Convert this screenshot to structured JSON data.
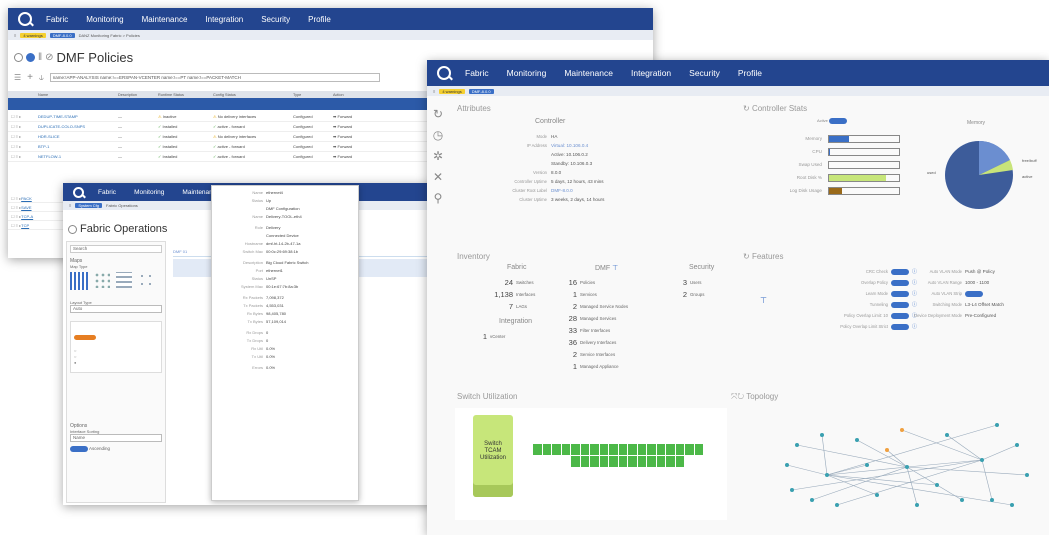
{
  "nav": {
    "items": [
      "Fabric",
      "Monitoring",
      "Maintenance",
      "Integration",
      "Security",
      "Profile"
    ]
  },
  "policies": {
    "warnings": "4 warnings",
    "version": "DMF-8.0.0",
    "crumb": "DANZ Monitoring Fabric > Policies",
    "title": "DMF Policies",
    "filter": "name:!APP-ANALYSIS name:!==ERSPAN-VCENTER name:!==PT name:!==PACKET-MATCH",
    "headers": [
      "Name",
      "Description",
      "Runtime Status",
      "Config Status",
      "Type",
      "Action"
    ],
    "rows": [
      {
        "name": "DEDUP-TIME-STAMP",
        "desc": "—",
        "run": "Inactive",
        "cfg": "No delivery interfaces",
        "type": "Configured",
        "act": "Forward"
      },
      {
        "name": "DUPLICATE-COLO-SNPS",
        "desc": "—",
        "run": "Installed",
        "cfg": "active - forward",
        "type": "Configured",
        "act": "Forward"
      },
      {
        "name": "HDR-SLICE",
        "desc": "—",
        "run": "Installed",
        "cfg": "No delivery interfaces",
        "type": "Configured",
        "act": "Forward"
      },
      {
        "name": "BTP-1",
        "desc": "—",
        "run": "Installed",
        "cfg": "active - forward",
        "type": "Configured",
        "act": "Forward"
      },
      {
        "name": "NETFLOW-1",
        "desc": "—",
        "run": "Installed",
        "cfg": "active - forward",
        "type": "Configured",
        "act": "Forward"
      }
    ],
    "extra_rows": [
      "PACK",
      "SAVE",
      "TCP-A",
      "TCP"
    ]
  },
  "fabric": {
    "sub_tag": "System Cfg",
    "crumb": "Fabric Operations",
    "title": "Fabric Operations",
    "search": "Search",
    "maps": "Maps",
    "map_type": "Map Type",
    "layout": "Layout Type",
    "layout_val": "Auto",
    "options": "Options",
    "interface_sorting": "Interface Sorting",
    "sort_val": "Name",
    "ascending": "Ascending",
    "colnote": "DMF 01",
    "details": [
      {
        "k": "Name",
        "v": "ethernet4"
      },
      {
        "k": "Status",
        "v": "Up"
      },
      {
        "k": "",
        "v": "DMF Configuration"
      },
      {
        "k": "Name",
        "v": "Delivery-TOOL-eth4"
      },
      {
        "k": "Role",
        "v": "Delivery"
      },
      {
        "k": "",
        "v": "Connected Device"
      },
      {
        "k": "Hostname",
        "v": "dmf-ht-14-2b-47-1a"
      },
      {
        "k": "Switch Mac",
        "v": "00:0c:29:69:38:1b"
      },
      {
        "k": "Description",
        "v": "Big Cloud Fabric Switch"
      },
      {
        "k": "Port",
        "v": "ethernet1"
      },
      {
        "k": "Status",
        "v": "UnSP"
      },
      {
        "k": "System Mac",
        "v": "00:1e:67:7b:8a:3b"
      },
      {
        "k": "Rx Packets",
        "v": "7,098,372"
      },
      {
        "k": "Tx Packets",
        "v": "4,553,031"
      },
      {
        "k": "Rx Bytes",
        "v": "98,405,780"
      },
      {
        "k": "Tx Bytes",
        "v": "57,109,014"
      },
      {
        "k": "Rx Drops",
        "v": "0"
      },
      {
        "k": "Tx Drops",
        "v": "0"
      },
      {
        "k": "Rx Util",
        "v": "0.0%"
      },
      {
        "k": "Tx Util",
        "v": "0.0%"
      },
      {
        "k": "Errors",
        "v": "0.0%"
      }
    ]
  },
  "dashboard": {
    "warnings": "4 warnings",
    "version": "DMF-8.0.0",
    "attributes": "Attributes",
    "controller": "Controller",
    "attr": [
      {
        "k": "Mode",
        "v": "HA"
      },
      {
        "k": "IP Address",
        "v": "Virtual: 10.106.0.4"
      },
      {
        "k": "",
        "v": "Active: 10.106.0.2"
      },
      {
        "k": "",
        "v": "Standby: 10.106.0.3"
      },
      {
        "k": "Version",
        "v": "8.0.0"
      },
      {
        "k": "Controller Uptime",
        "v": "5 days, 12 hours, 43 mins"
      },
      {
        "k": "Cluster Root Label",
        "v": "DMF-8.0.0"
      },
      {
        "k": "Cluster Uptime",
        "v": "3 weeks, 2 days, 14 hours"
      }
    ],
    "stats_title": "Controller Stats",
    "active_label": "Active",
    "stats": [
      {
        "k": "Memory",
        "f": 0.28,
        "c": "#3a6fc6"
      },
      {
        "k": "CPU",
        "f": 0.02,
        "c": "#3a6fc6"
      },
      {
        "k": "Swap Used",
        "f": 0,
        "c": "#3a6fc6"
      },
      {
        "k": "Root Disk %",
        "f": 0.82,
        "c": "#c7e67a"
      },
      {
        "k": "Log Disk Usage",
        "f": 0.18,
        "c": "#9a6a1a"
      }
    ],
    "memory_title": "Memory",
    "pie_labels": [
      "free/buff",
      "used",
      "active"
    ],
    "inventory": "Inventory",
    "fabric_h": "Fabric",
    "dmf_h": "DMF",
    "sec_h": "Security",
    "integ_h": "Integration",
    "fabric_items": [
      {
        "n": "24",
        "l": "Switches"
      },
      {
        "n": "1,138",
        "l": "Interfaces"
      },
      {
        "n": "7",
        "l": "LAGs"
      }
    ],
    "integ_items": [
      {
        "n": "1",
        "l": "vCenter"
      }
    ],
    "dmf_items": [
      {
        "n": "16",
        "l": "Policies"
      },
      {
        "n": "1",
        "l": "Services"
      },
      {
        "n": "2",
        "l": "Managed Service Nodes"
      },
      {
        "n": "28",
        "l": "Managed Services"
      },
      {
        "n": "33",
        "l": "Filter Interfaces"
      },
      {
        "n": "36",
        "l": "Delivery Interfaces"
      },
      {
        "n": "2",
        "l": "Service Interfaces"
      },
      {
        "n": "1",
        "l": "Managed Appliance"
      }
    ],
    "sec_items": [
      {
        "n": "3",
        "l": "Users"
      },
      {
        "n": "2",
        "l": "Groups"
      }
    ],
    "features": "Features",
    "feat_left": [
      "CRC Check",
      "Overlap Policy",
      "Learn Mode",
      "Tunneling",
      "Policy Overlap Limit: 10",
      "Policy Overlap Limit Strict"
    ],
    "feat_right": [
      {
        "k": "Auto VLAN Mode",
        "v": "Push @ Policy"
      },
      {
        "k": "Auto VLAN Range",
        "v": "1000 - 1100"
      },
      {
        "k": "Auto VLAN Strip",
        "v": ""
      },
      {
        "k": "Switching Mode",
        "v": "L3-L4 Offset Match"
      },
      {
        "k": "Device Deployment Mode",
        "v": "Pre-Configured"
      }
    ],
    "switch_util": "Switch Utilization",
    "tcam": "Switch TCAM Utilization",
    "topology": "Topology"
  }
}
